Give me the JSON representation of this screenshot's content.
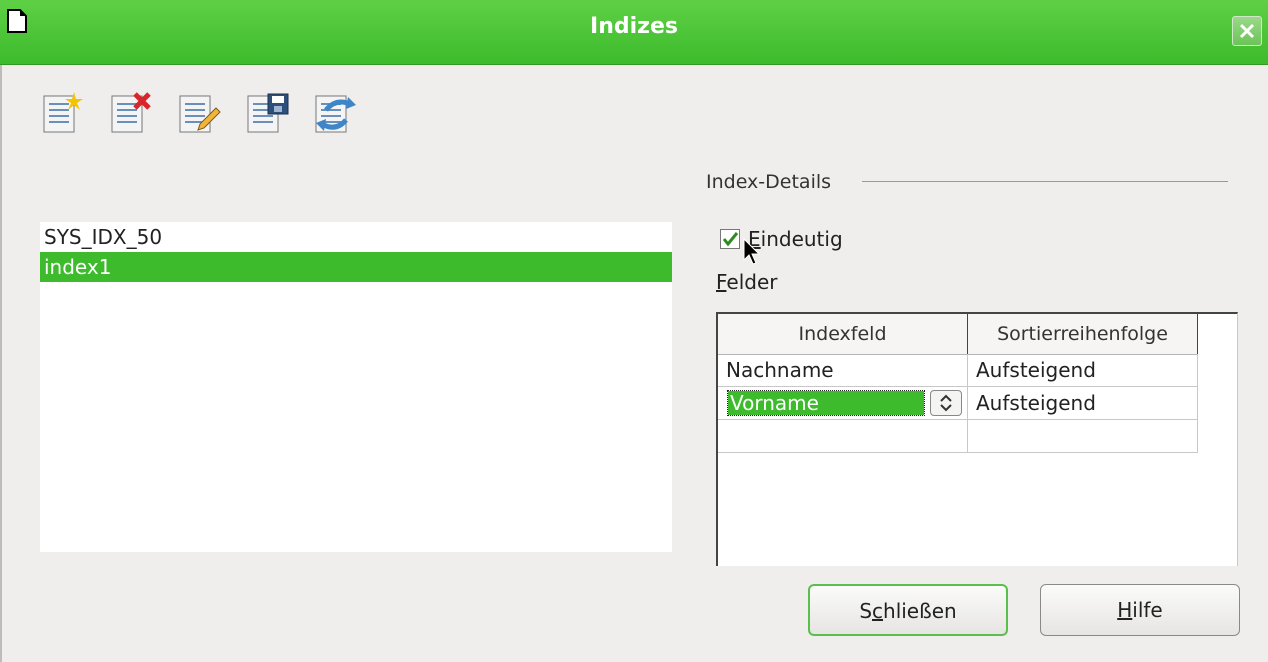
{
  "window": {
    "title": "Indizes"
  },
  "toolbar": {
    "buttons": [
      {
        "icon": "new-index-icon"
      },
      {
        "icon": "delete-index-icon"
      },
      {
        "icon": "rename-index-icon"
      },
      {
        "icon": "save-index-icon"
      },
      {
        "icon": "reset-index-icon"
      }
    ]
  },
  "index_list": {
    "items": [
      "SYS_IDX_50",
      "index1"
    ],
    "selected": "index1"
  },
  "details": {
    "group_label": "Index-Details",
    "unique_checkbox": {
      "label_first": "E",
      "label_rest": "indeutig",
      "checked": true
    },
    "fields_label_first": "F",
    "fields_label_rest": "elder"
  },
  "grid": {
    "headers": [
      "Indexfeld",
      "Sortierreihenfolge"
    ],
    "rows": [
      {
        "field": "Nachname",
        "order": "Aufsteigend"
      },
      {
        "field": "Vorname",
        "order": "Aufsteigend"
      },
      {
        "field": "",
        "order": ""
      }
    ]
  },
  "buttons": {
    "close_pre": "S",
    "close_mn": "c",
    "close_post": "hließen",
    "help_mn": "H",
    "help_post": "ilfe"
  },
  "colors": {
    "accent": "#3dbb2c",
    "title_bar": "#4cc337"
  }
}
